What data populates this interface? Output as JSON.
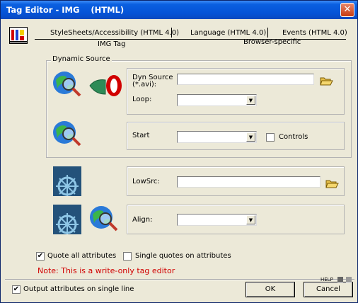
{
  "window": {
    "title": "Tag Editor - IMG    (HTML)",
    "close_glyph": "✕"
  },
  "tabs": [
    {
      "label": "StyleSheets/Accessibility (HTML 4.0)"
    },
    {
      "label": "Language (HTML 4.0)"
    },
    {
      "label": "Events (HTML 4.0)"
    },
    {
      "label": "IMG Tag"
    },
    {
      "label": "Browser-specific"
    }
  ],
  "dynamic_source": {
    "legend": "Dynamic Source",
    "dyn_source_label": "Dyn Source\n(*.avi):",
    "dyn_source_value": "",
    "loop_label": "Loop:",
    "loop_value": "",
    "start_label": "Start",
    "start_value": "",
    "controls_label": "Controls",
    "controls_checked": false
  },
  "lowsrc": {
    "label": "LowSrc:",
    "value": ""
  },
  "align": {
    "label": "Align:",
    "value": ""
  },
  "options": {
    "quote_all_label": "Quote all attributes",
    "quote_all_checked": true,
    "single_quotes_label": "Single quotes on attributes",
    "single_quotes_checked": false,
    "note": "Note: This is a write-only tag editor",
    "output_single_line_label": "Output attributes on single line",
    "output_single_line_checked": true
  },
  "buttons": {
    "ok": "OK",
    "cancel": "Cancel",
    "help": "HELP"
  },
  "check_glyph": "✔",
  "dropdown_glyph": "▼",
  "colors": {
    "title_bar": "#0553d6",
    "note_red": "#d10000",
    "close_red": "#c83c12"
  }
}
